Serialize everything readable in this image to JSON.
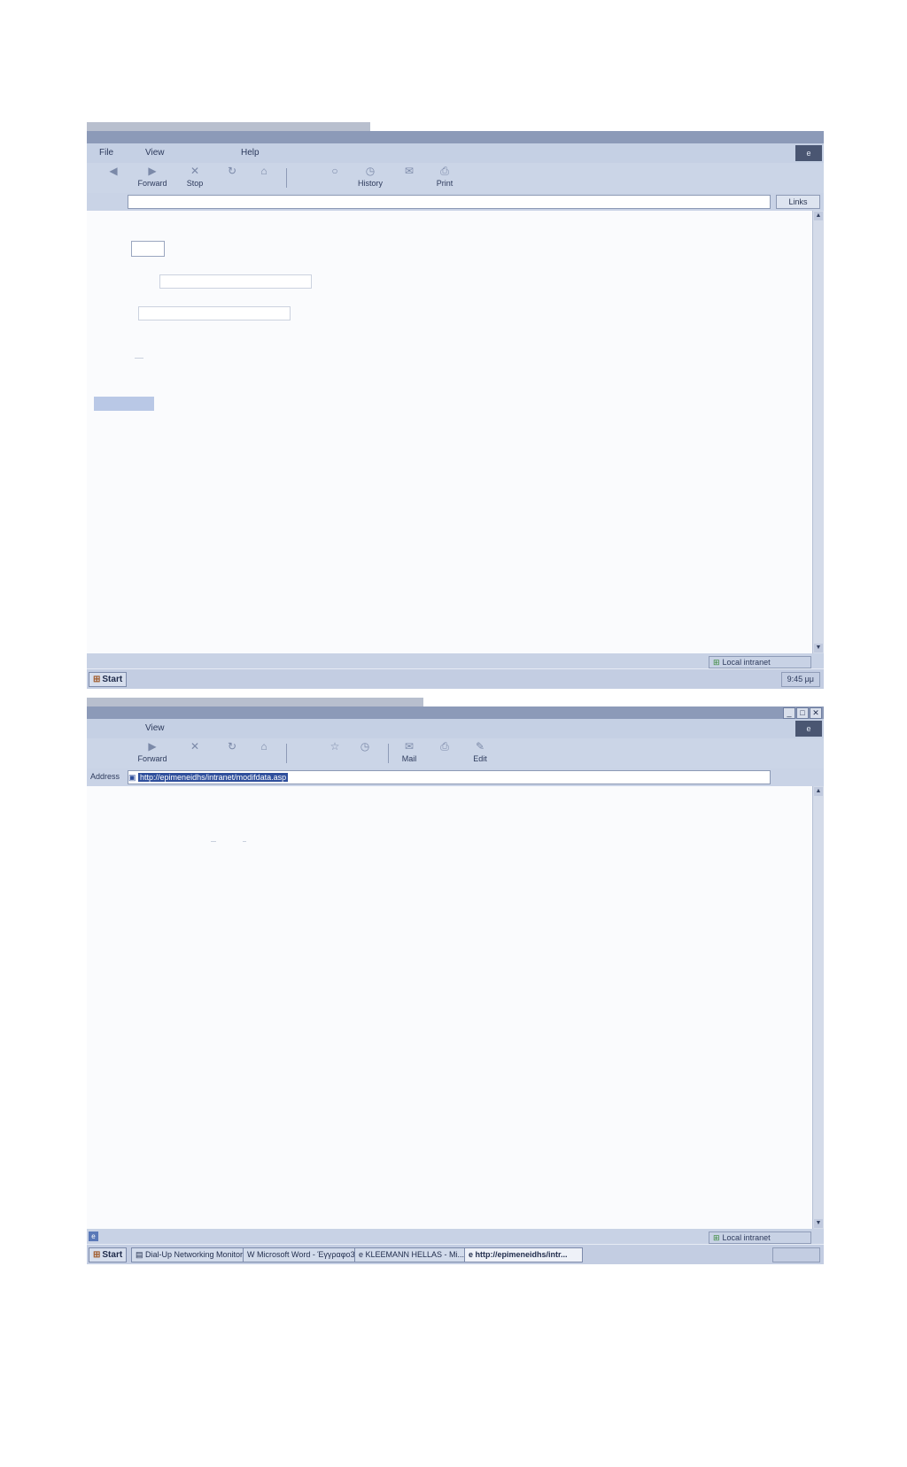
{
  "screens": [
    {
      "menu": {
        "file": "File",
        "view": "View",
        "help": "Help"
      },
      "toolbar": {
        "forward": "Forward",
        "stop": "Stop",
        "history": "History",
        "print": "Print"
      },
      "address": {
        "label": "",
        "url": ""
      },
      "links": "Links",
      "status": {
        "zone": "Local intranet"
      },
      "taskbar": {
        "start": "Start",
        "clock": "9:45 μμ"
      }
    },
    {
      "menu": {
        "view": "View"
      },
      "toolbar": {
        "forward": "Forward",
        "mail": "Mail",
        "edit": "Edit"
      },
      "address": {
        "label": "Address",
        "url": "http://epimeneidhs/intranet/modifdata.asp"
      },
      "status": {
        "zone": "Local intranet"
      },
      "taskbar": {
        "start": "Start",
        "tasks": [
          "Dial-Up Networking Monitor",
          "Microsoft Word - Έγγραφο3",
          "KLEEMANN HELLAS - Mi...",
          "http://epimeneidhs/intr..."
        ]
      }
    }
  ],
  "icons": {
    "back": "left-arrow-icon",
    "forward": "right-arrow-icon",
    "stop": "stop-icon",
    "refresh": "refresh-icon",
    "home": "home-icon",
    "history": "history-icon",
    "mail": "mail-icon",
    "print": "print-icon",
    "edit": "edit-icon",
    "ie": "ie-logo-icon",
    "page": "page-icon",
    "zone": "intranet-zone-icon",
    "start": "windows-flag-icon"
  },
  "colors": {
    "titlebar": "#8c9ab8",
    "address_selection": "#2f4f9c",
    "button_fill": "#b9c8e6"
  }
}
